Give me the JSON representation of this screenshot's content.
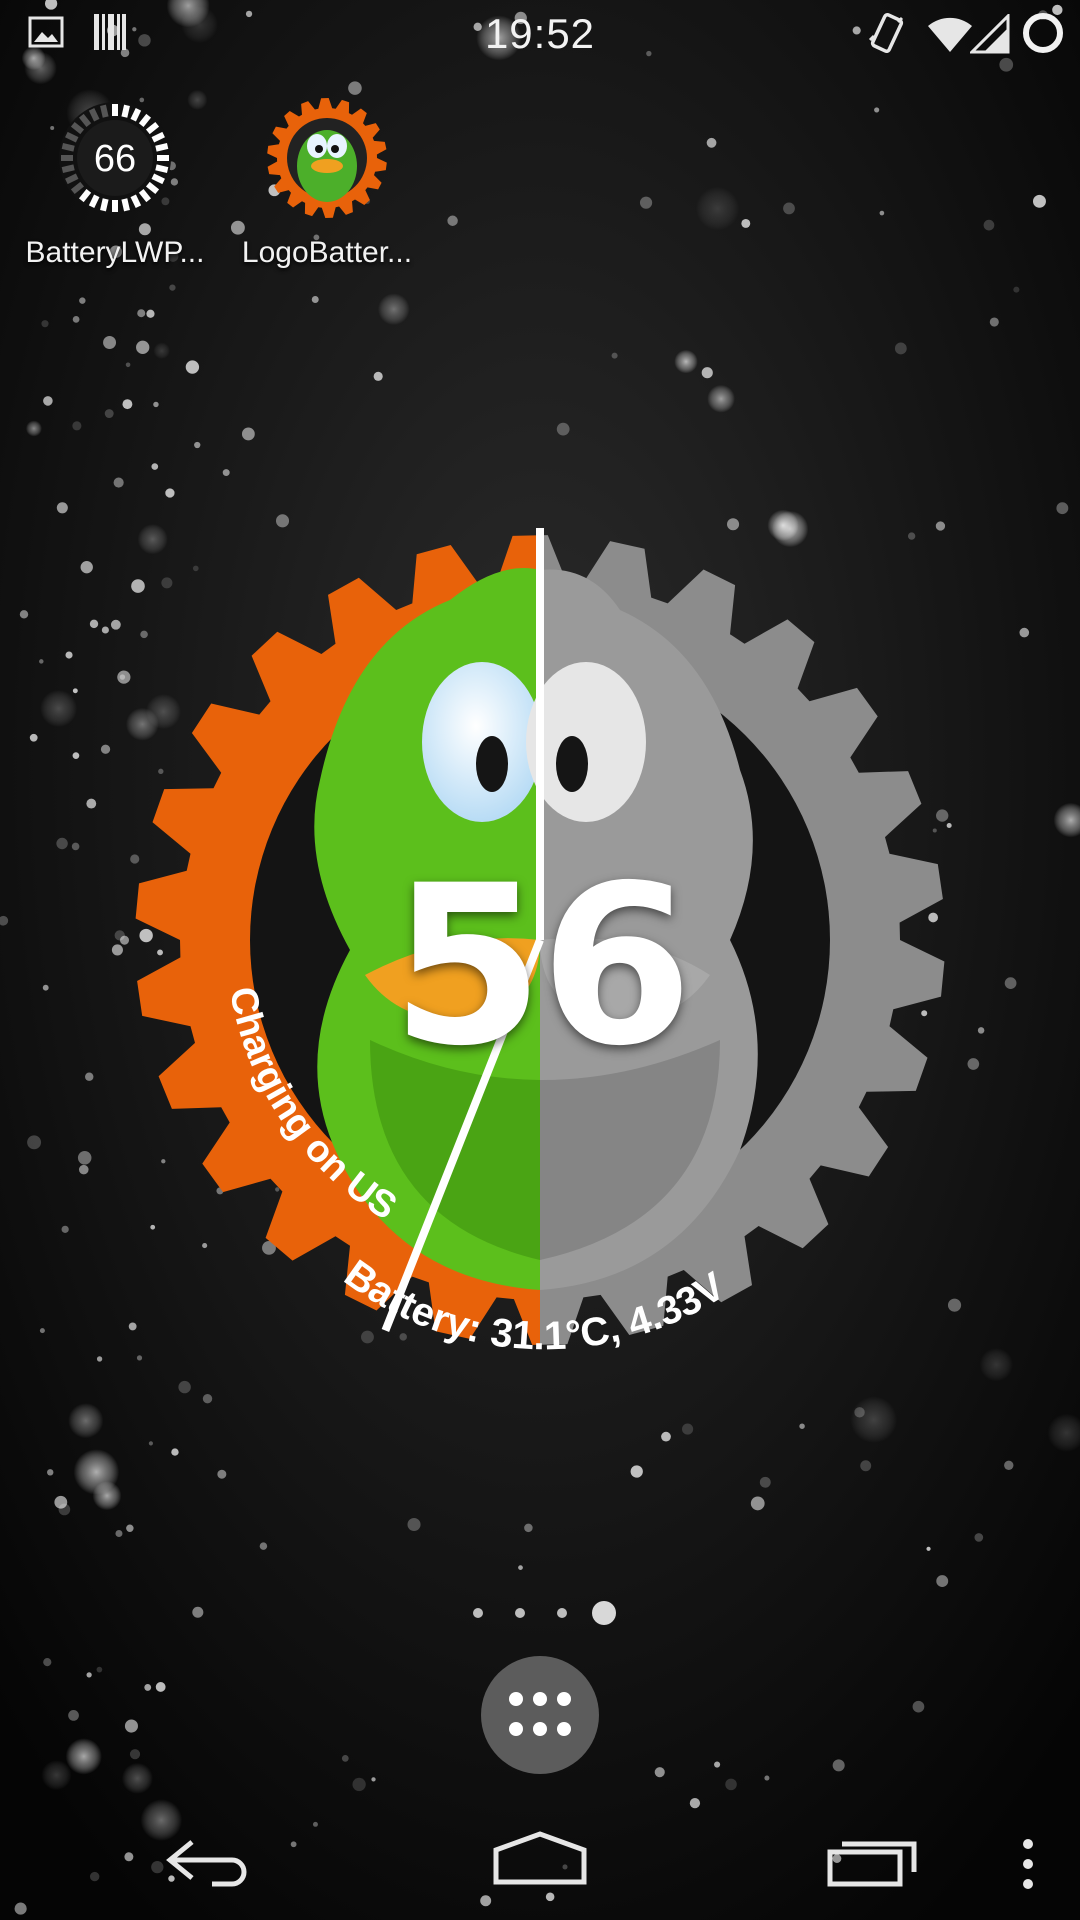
{
  "status_bar": {
    "time": "19:52",
    "left_icons": [
      "picture-icon",
      "barcode-icon"
    ],
    "right_icons": [
      "vibrate-icon",
      "wifi-icon",
      "signal-icon",
      "battery-ring-icon"
    ]
  },
  "home_icons": [
    {
      "label": "BatteryLWP...",
      "icon": "battery-lwp-icon",
      "badge": "66"
    },
    {
      "label": "LogoBatter...",
      "icon": "duck-logo-icon"
    }
  ],
  "widget": {
    "percent": "56",
    "level": 0.56,
    "status_text": "Charging on USB",
    "battery_text": "Battery: 31.1°C, 4.33V",
    "colors": {
      "orange": "#e8620a",
      "green": "#5cbf1c",
      "gray": "#8c8c8c"
    }
  },
  "page_indicator": {
    "pages": 4,
    "current": 4
  },
  "nav_bar": {
    "buttons": [
      "back-icon",
      "home-icon",
      "recents-icon",
      "overflow-menu-icon"
    ]
  }
}
